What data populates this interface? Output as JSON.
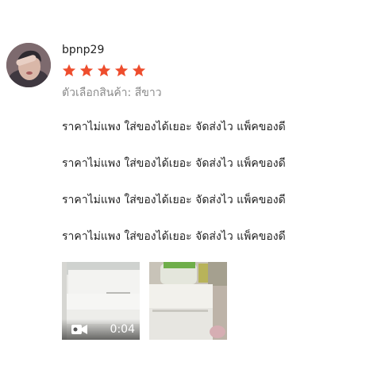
{
  "review": {
    "username": "bpnp29",
    "rating": 5,
    "max_rating": 5,
    "variation": "ตัวเลือกสินค้า: สีขาว",
    "comment_lines": [
      "ราคาไม่แพง ใส่ของได้เยอะ จัดส่งไว แพ็คของดี",
      "ราคาไม่แพง ใส่ของได้เยอะ จัดส่งไว แพ็คของดี",
      "ราคาไม่แพง ใส่ของได้เยอะ จัดส่งไว แพ็คของดี",
      "ราคาไม่แพง ใส่ของได้เยอะ จัดส่งไว แพ็คของดี"
    ],
    "media": [
      {
        "type": "video",
        "duration": "0:04",
        "icon": "video-camera-icon"
      },
      {
        "type": "image"
      }
    ]
  },
  "colors": {
    "star": "#ee4d2d",
    "variation_text": "#8a8a8a",
    "text": "#222222"
  }
}
